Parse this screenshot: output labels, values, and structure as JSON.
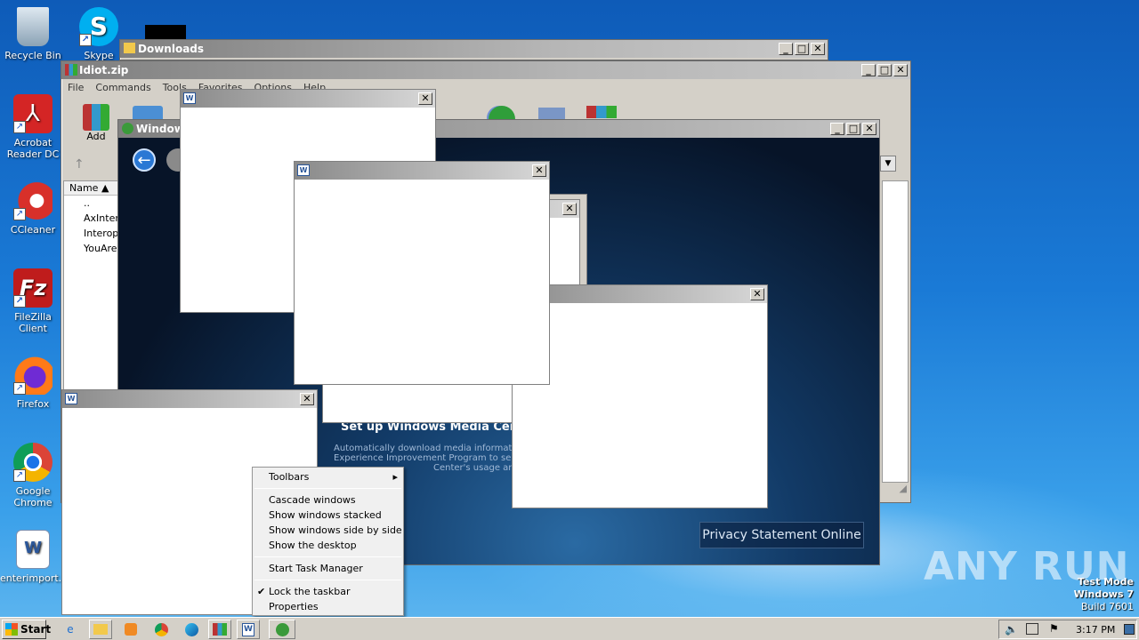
{
  "desktop": {
    "icons": [
      {
        "label": "Recycle Bin",
        "icon": "recycle-bin-icon",
        "color": "#9fb6c8"
      },
      {
        "label": "Skype",
        "icon": "skype-icon",
        "color": "#00aff0",
        "glyph": "S"
      },
      {
        "label": "Acrobat Reader DC",
        "icon": "acrobat-icon",
        "color": "#d42525"
      },
      {
        "label": "CCleaner",
        "icon": "ccleaner-icon",
        "color": "#d8302a"
      },
      {
        "label": "FileZilla Client",
        "icon": "filezilla-icon",
        "color": "#bf1c1c",
        "glyph": "Fz"
      },
      {
        "label": "Firefox",
        "icon": "firefox-icon",
        "color": "#ff7a18"
      },
      {
        "label": "Google Chrome",
        "icon": "chrome-icon",
        "color": "#db4437"
      },
      {
        "label": "enterimport....",
        "icon": "word-doc-icon",
        "color": "#2b579a",
        "glyph": "W"
      }
    ]
  },
  "windows": {
    "downloads": {
      "title": "Downloads"
    },
    "winrar": {
      "title": "Idiot.zip",
      "menu": [
        "File",
        "Commands",
        "Tools",
        "Favorites",
        "Options",
        "Help"
      ],
      "toolbar": [
        "Add"
      ],
      "list_header": "Name",
      "list_rows": [
        "..",
        "AxInter",
        "Interop",
        "YouAre"
      ]
    },
    "mediacenter": {
      "title": "Windows",
      "heading": "Set up Windows Media Center w",
      "desc_lines": [
        "Automatically download media information fr",
        "Experience Improvement Program to send da",
        "Center's usage and p"
      ],
      "privacy_button": "Privacy Statement Online"
    }
  },
  "context_menu": {
    "items": [
      "Toolbars",
      "Cascade windows",
      "Show windows stacked",
      "Show windows side by side",
      "Show the desktop",
      "Start Task Manager",
      "Lock the taskbar",
      "Properties"
    ]
  },
  "taskbar": {
    "start": "Start",
    "clock": "3:17 PM"
  },
  "watermark": {
    "brand": "ANY RUN",
    "mode": "Test Mode",
    "os": "Windows 7",
    "build": "Build 7601"
  }
}
